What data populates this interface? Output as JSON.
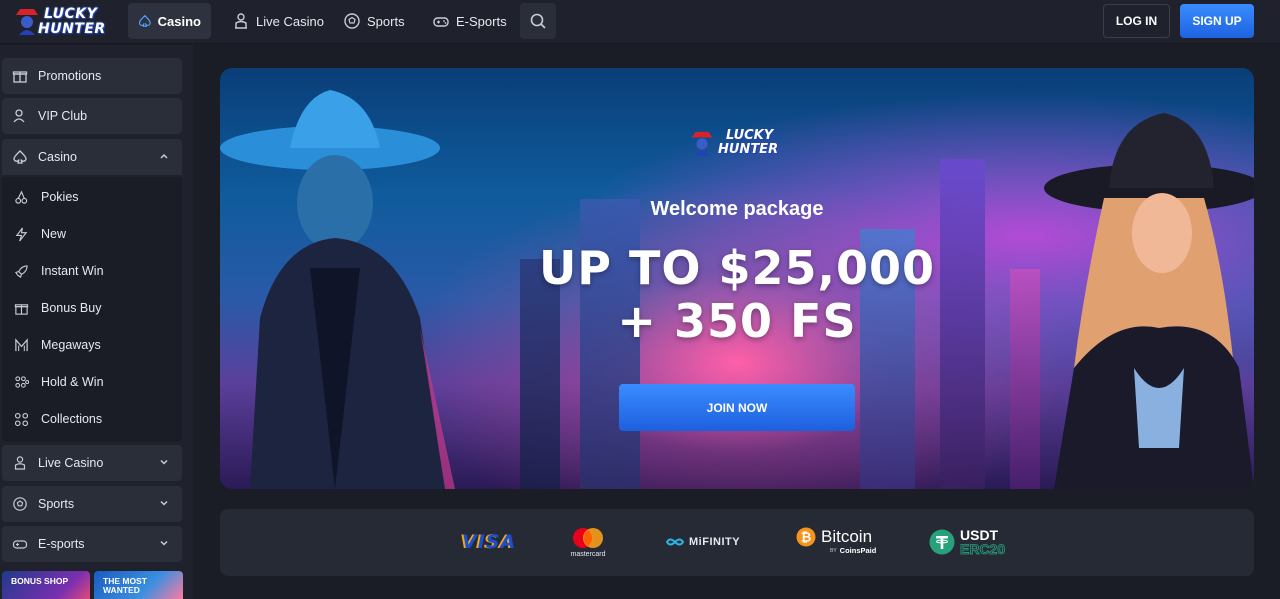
{
  "brand": {
    "line1": "LUCKY",
    "line2": "HUNTER"
  },
  "header": {
    "nav": [
      {
        "label": "Casino",
        "icon": "spade-icon",
        "active": true
      },
      {
        "label": "Live Casino",
        "icon": "dealer-icon"
      },
      {
        "label": "Sports",
        "icon": "soccer-ball-icon"
      },
      {
        "label": "E-Sports",
        "icon": "gamepad-icon"
      }
    ],
    "search_icon": "search-icon",
    "login_label": "LOG IN",
    "signup_label": "SIGN UP"
  },
  "sidebar": {
    "promotions": "Promotions",
    "vip": "VIP Club",
    "casino": "Casino",
    "casino_sub": [
      "Pokies",
      "New",
      "Instant Win",
      "Bonus Buy",
      "Megaways",
      "Hold & Win",
      "Collections"
    ],
    "live_casino": "Live Casino",
    "sports": "Sports",
    "esports": "E-sports",
    "tiles": [
      {
        "line1": "BONUS SHOP",
        "line2": ""
      },
      {
        "line1": "THE MOST",
        "line2": "WANTED"
      }
    ]
  },
  "banner": {
    "welcome": "Welcome package",
    "headline_1": "UP TO $25,000",
    "headline_2": "+ 350 FS",
    "cta": "JOIN NOW"
  },
  "payments": {
    "visa": "VISA",
    "mastercard": "mastercard",
    "mifinity": "MiFINITY",
    "bitcoin": "Bitcoin",
    "bitcoin_by": "BY",
    "coinspaid": "CoinsPaid",
    "usdt": "USDT",
    "erc20": "ERC20"
  },
  "colors": {
    "accent": "#2f7bf5",
    "bg": "#1a1d26",
    "panel": "#2a2e39",
    "text": "#e6e8ee"
  }
}
